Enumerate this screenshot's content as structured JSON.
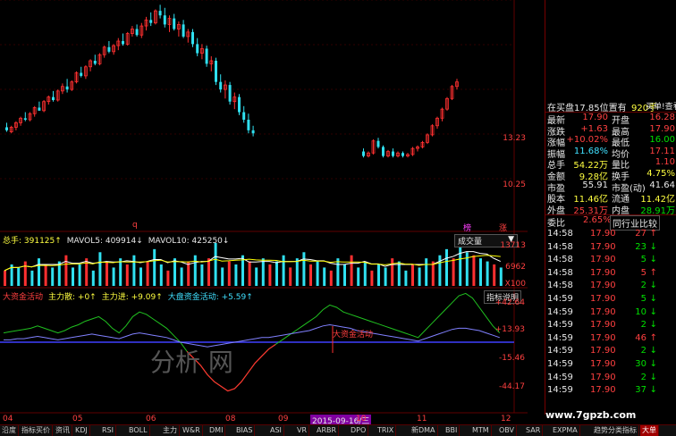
{
  "candles": [
    {
      "o": 13.9,
      "h": 14.2,
      "l": 13.6,
      "c": 13.7
    },
    {
      "o": 13.6,
      "h": 14.0,
      "l": 13.5,
      "c": 13.9
    },
    {
      "o": 13.9,
      "h": 14.3,
      "l": 13.7,
      "c": 14.2
    },
    {
      "o": 14.2,
      "h": 14.6,
      "l": 14.0,
      "c": 14.5
    },
    {
      "o": 14.5,
      "h": 14.9,
      "l": 14.3,
      "c": 14.4
    },
    {
      "o": 14.4,
      "h": 14.9,
      "l": 14.3,
      "c": 14.8
    },
    {
      "o": 14.8,
      "h": 15.3,
      "l": 14.6,
      "c": 15.2
    },
    {
      "o": 15.2,
      "h": 15.6,
      "l": 15.0,
      "c": 15.0
    },
    {
      "o": 15.0,
      "h": 15.7,
      "l": 14.9,
      "c": 15.6
    },
    {
      "o": 15.6,
      "h": 16.0,
      "l": 15.4,
      "c": 15.9
    },
    {
      "o": 15.9,
      "h": 16.3,
      "l": 15.6,
      "c": 15.7
    },
    {
      "o": 15.7,
      "h": 16.4,
      "l": 15.6,
      "c": 16.3
    },
    {
      "o": 16.3,
      "h": 16.8,
      "l": 16.1,
      "c": 16.6
    },
    {
      "o": 16.6,
      "h": 17.1,
      "l": 16.2,
      "c": 16.4
    },
    {
      "o": 16.4,
      "h": 17.0,
      "l": 16.3,
      "c": 16.9
    },
    {
      "o": 16.9,
      "h": 17.6,
      "l": 16.8,
      "c": 17.5
    },
    {
      "o": 17.5,
      "h": 17.9,
      "l": 17.2,
      "c": 17.3
    },
    {
      "o": 17.3,
      "h": 18.0,
      "l": 17.1,
      "c": 17.9
    },
    {
      "o": 17.9,
      "h": 18.4,
      "l": 17.6,
      "c": 18.3
    },
    {
      "o": 18.3,
      "h": 18.7,
      "l": 18.0,
      "c": 18.1
    },
    {
      "o": 18.1,
      "h": 18.8,
      "l": 18.0,
      "c": 18.7
    },
    {
      "o": 18.7,
      "h": 19.3,
      "l": 18.5,
      "c": 19.2
    },
    {
      "o": 19.2,
      "h": 19.6,
      "l": 18.8,
      "c": 18.9
    },
    {
      "o": 18.9,
      "h": 19.4,
      "l": 18.7,
      "c": 19.3
    },
    {
      "o": 19.3,
      "h": 19.8,
      "l": 19.0,
      "c": 19.6
    },
    {
      "o": 19.6,
      "h": 20.1,
      "l": 19.3,
      "c": 19.4
    },
    {
      "o": 19.4,
      "h": 20.2,
      "l": 19.3,
      "c": 20.1
    },
    {
      "o": 20.1,
      "h": 20.6,
      "l": 19.9,
      "c": 20.4
    },
    {
      "o": 20.4,
      "h": 20.7,
      "l": 19.9,
      "c": 20.0
    },
    {
      "o": 20.0,
      "h": 20.8,
      "l": 19.8,
      "c": 20.6
    },
    {
      "o": 20.6,
      "h": 21.2,
      "l": 20.3,
      "c": 21.0
    },
    {
      "o": 21.0,
      "h": 21.5,
      "l": 20.6,
      "c": 20.8
    },
    {
      "o": 20.8,
      "h": 21.7,
      "l": 20.7,
      "c": 21.6
    },
    {
      "o": 21.6,
      "h": 22.0,
      "l": 21.1,
      "c": 21.3
    },
    {
      "o": 21.3,
      "h": 21.8,
      "l": 20.5,
      "c": 20.7
    },
    {
      "o": 20.7,
      "h": 21.3,
      "l": 20.2,
      "c": 21.1
    },
    {
      "o": 21.1,
      "h": 21.4,
      "l": 20.3,
      "c": 20.4
    },
    {
      "o": 20.4,
      "h": 20.9,
      "l": 19.9,
      "c": 20.7
    },
    {
      "o": 20.7,
      "h": 21.0,
      "l": 19.8,
      "c": 19.9
    },
    {
      "o": 19.9,
      "h": 20.4,
      "l": 19.5,
      "c": 20.2
    },
    {
      "o": 20.2,
      "h": 20.4,
      "l": 19.2,
      "c": 19.4
    },
    {
      "o": 19.4,
      "h": 19.8,
      "l": 18.6,
      "c": 18.8
    },
    {
      "o": 18.8,
      "h": 19.4,
      "l": 18.4,
      "c": 19.1
    },
    {
      "o": 19.1,
      "h": 19.3,
      "l": 17.9,
      "c": 18.1
    },
    {
      "o": 18.1,
      "h": 18.6,
      "l": 17.6,
      "c": 18.3
    },
    {
      "o": 18.3,
      "h": 18.5,
      "l": 16.7,
      "c": 16.9
    },
    {
      "o": 16.9,
      "h": 17.4,
      "l": 16.2,
      "c": 16.4
    },
    {
      "o": 16.4,
      "h": 17.0,
      "l": 15.8,
      "c": 16.7
    },
    {
      "o": 16.7,
      "h": 16.9,
      "l": 15.4,
      "c": 15.6
    },
    {
      "o": 15.6,
      "h": 16.2,
      "l": 15.1,
      "c": 15.9
    },
    {
      "o": 15.9,
      "h": 16.1,
      "l": 14.7,
      "c": 14.9
    },
    {
      "o": 14.9,
      "h": 15.3,
      "l": 14.2,
      "c": 14.4
    },
    {
      "o": 14.4,
      "h": 14.8,
      "l": 13.5,
      "c": 13.7
    },
    {
      "o": 13.7,
      "h": 14.0,
      "l": 13.3,
      "c": 13.5
    },
    {
      "o": 12.3,
      "h": 12.5,
      "l": 11.9,
      "c": 12.0
    },
    {
      "o": 12.0,
      "h": 12.3,
      "l": 11.9,
      "c": 12.2
    },
    {
      "o": 12.2,
      "h": 13.1,
      "l": 12.1,
      "c": 13.0
    },
    {
      "o": 13.0,
      "h": 13.2,
      "l": 12.5,
      "c": 12.6
    },
    {
      "o": 12.6,
      "h": 12.7,
      "l": 11.9,
      "c": 12.0
    },
    {
      "o": 12.0,
      "h": 12.4,
      "l": 11.9,
      "c": 12.3
    },
    {
      "o": 12.3,
      "h": 12.5,
      "l": 11.9,
      "c": 12.0
    },
    {
      "o": 12.0,
      "h": 12.3,
      "l": 11.9,
      "c": 12.2
    },
    {
      "o": 12.2,
      "h": 12.3,
      "l": 11.9,
      "c": 12.0
    },
    {
      "o": 12.0,
      "h": 12.2,
      "l": 11.9,
      "c": 12.1
    },
    {
      "o": 12.1,
      "h": 12.6,
      "l": 12.0,
      "c": 12.5
    },
    {
      "o": 12.5,
      "h": 12.7,
      "l": 12.3,
      "c": 12.6
    },
    {
      "o": 12.6,
      "h": 13.0,
      "l": 12.5,
      "c": 12.9
    },
    {
      "o": 12.9,
      "h": 13.5,
      "l": 12.8,
      "c": 13.4
    },
    {
      "o": 13.4,
      "h": 14.1,
      "l": 13.3,
      "c": 14.0
    },
    {
      "o": 14.0,
      "h": 14.6,
      "l": 13.8,
      "c": 14.5
    },
    {
      "o": 14.5,
      "h": 15.2,
      "l": 14.3,
      "c": 15.1
    },
    {
      "o": 15.1,
      "h": 15.9,
      "l": 15.0,
      "c": 15.8
    },
    {
      "o": 15.8,
      "h": 16.7,
      "l": 15.7,
      "c": 16.6
    },
    {
      "o": 16.6,
      "h": 17.1,
      "l": 16.4,
      "c": 16.9
    }
  ],
  "volumes": [
    5,
    7,
    6,
    8,
    5,
    9,
    7,
    6,
    8,
    10,
    6,
    7,
    9,
    5,
    11,
    8,
    6,
    9,
    7,
    10,
    6,
    8,
    12,
    7,
    5,
    9,
    6,
    8,
    10,
    7,
    9,
    14,
    6,
    8,
    7,
    10,
    8,
    6,
    9,
    7,
    8,
    10,
    6,
    9,
    11,
    7,
    8,
    6,
    5,
    9,
    7,
    10,
    6,
    8,
    5,
    7,
    6,
    9,
    8,
    5,
    7,
    6,
    9,
    8,
    10,
    12,
    9,
    14,
    11,
    10,
    9,
    8,
    7,
    6
  ],
  "flow": {
    "a": [
      8,
      9,
      10,
      11,
      12,
      14,
      12,
      10,
      8,
      10,
      13,
      15,
      18,
      20,
      22,
      18,
      12,
      8,
      14,
      22,
      26,
      24,
      20,
      16,
      12,
      6,
      0,
      -8,
      -14,
      -20,
      -28,
      -34,
      -38,
      -42,
      -40,
      -34,
      -26,
      -18,
      -12,
      -6,
      -2,
      2,
      6,
      10,
      14,
      18,
      22,
      28,
      32,
      30,
      26,
      24,
      22,
      20,
      18,
      16,
      14,
      12,
      10,
      8,
      6,
      4,
      10,
      16,
      22,
      28,
      34,
      40,
      42,
      38,
      30,
      22,
      14,
      8
    ],
    "b": [
      2,
      2,
      3,
      3,
      4,
      5,
      4,
      3,
      2,
      3,
      4,
      5,
      6,
      7,
      6,
      5,
      4,
      3,
      5,
      7,
      8,
      7,
      6,
      5,
      4,
      2,
      0,
      -1,
      -2,
      -3,
      -4,
      -3,
      -2,
      -1,
      0,
      1,
      2,
      3,
      4,
      4,
      5,
      6,
      7,
      8,
      9,
      10,
      12,
      14,
      15,
      14,
      13,
      12,
      10,
      9,
      8,
      7,
      6,
      5,
      4,
      3,
      2,
      1,
      3,
      5,
      7,
      9,
      11,
      12,
      12,
      11,
      10,
      8,
      6,
      4
    ]
  },
  "header": {
    "price_marker": "q",
    "vol_legend": [
      {
        "text": "总手: 391125↑",
        "cls": "yel"
      },
      {
        "text": "MAVOL5: 409914↓",
        "cls": "wht"
      },
      {
        "text": "MAVOL10: 425250↓",
        "cls": "wht"
      }
    ],
    "vol_btn_left": "榜",
    "vol_btn_right": "涨",
    "vol_select": "成交量",
    "vol_axis": [
      "13713",
      "6962",
      "X100"
    ],
    "price_axis": [
      "13.23",
      "10.25"
    ],
    "flow_legend": [
      {
        "text": "大资金活动",
        "cls": "red"
      },
      {
        "text": "主力散: +0↑",
        "cls": "yel"
      },
      {
        "text": "主力进: +9.09↑",
        "cls": "yel"
      },
      {
        "text": "大盘资金活动: +5.59↑",
        "cls": "cyn"
      }
    ],
    "flow_btn": "指标说明",
    "flow_axis": [
      "+42.64",
      "+13.93",
      "-15.46",
      "-44.17"
    ],
    "flow_note": "大资金活动",
    "watermark": "分析    网",
    "date_axis": [
      "04",
      "05",
      "06",
      "08",
      "09",
      "11",
      "12"
    ],
    "date_highlight": "2015-09-16/三",
    "date_suffix": "10",
    "site_url": "www.7gpzb.com"
  },
  "quote": {
    "title_left": "在买盘17.85位置有",
    "title_mid": "920手",
    "title_right": "买单!查看详细",
    "rows": [
      [
        "最新",
        "17.90",
        "red",
        "开盘",
        "16.28",
        "red"
      ],
      [
        "涨跌",
        "+1.63",
        "red",
        "最高",
        "17.90",
        "red"
      ],
      [
        "涨幅",
        "+10.02%",
        "red",
        "最低",
        "16.00",
        "grn"
      ],
      [
        "振幅",
        "11.68%",
        "cyn",
        "均价",
        "17.11",
        "red"
      ],
      [
        "总手",
        "54.22万",
        "yel",
        "量比",
        "1.10",
        "red"
      ],
      [
        "金额",
        "9.28亿",
        "yel",
        "换手",
        "4.75%",
        "yel"
      ],
      [
        "市盈",
        "55.91",
        "wht",
        "市盈(动)",
        "41.64",
        "wht"
      ],
      [
        "股本",
        "11.46亿",
        "yel",
        "流通",
        "11.42亿",
        "yel"
      ],
      [
        "外盘",
        "25.31万",
        "red",
        "内盘",
        "28.91万",
        "grn"
      ]
    ],
    "weibi_label": "委比",
    "weibi_value": "2.65%",
    "industry_tab": "同行业比较"
  },
  "ticks": [
    [
      "14:58",
      "17.90",
      "27",
      "up"
    ],
    [
      "14:58",
      "17.90",
      "23",
      "dn"
    ],
    [
      "14:58",
      "17.90",
      "5",
      "dn"
    ],
    [
      "14:58",
      "17.90",
      "5",
      "up"
    ],
    [
      "14:58",
      "17.90",
      "2",
      "dn"
    ],
    [
      "14:59",
      "17.90",
      "5",
      "dn"
    ],
    [
      "14:59",
      "17.90",
      "10",
      "dn"
    ],
    [
      "14:59",
      "17.90",
      "2",
      "dn"
    ],
    [
      "14:59",
      "17.90",
      "46",
      "up"
    ],
    [
      "14:59",
      "17.90",
      "2",
      "dn"
    ],
    [
      "14:59",
      "17.90",
      "30",
      "dn"
    ],
    [
      "14:59",
      "17.90",
      "2",
      "dn"
    ],
    [
      "14:59",
      "17.90",
      "37",
      "dn"
    ]
  ],
  "tabs": [
    "沿度",
    "指标买价",
    "资讯",
    "KDJ",
    "RSI",
    "BOLL",
    "主力",
    "W&R",
    "DMI",
    "BIAS",
    "ASI",
    "VR",
    "ARBR",
    "DPO",
    "TRIX",
    "新DMA",
    "BBI",
    "MTM",
    "OBV",
    "SAR",
    "EXPMA",
    "趋势分类指标",
    "大单"
  ],
  "colors": {
    "up": "#ff3030",
    "down": "#30e0f0",
    "grid": "#600000"
  }
}
